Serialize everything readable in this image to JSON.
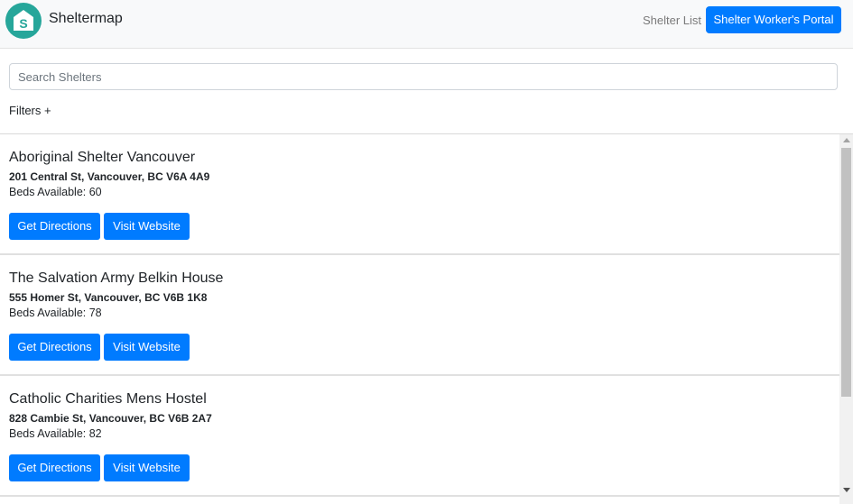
{
  "header": {
    "brand": "Sheltermap",
    "logo_icon": "house-s-logo-icon",
    "logo_color": "#26a69a",
    "nav_link": "Shelter List",
    "portal_button": "Shelter Worker's Portal",
    "accent": "#007bff"
  },
  "search": {
    "placeholder": "Search Shelters",
    "value": "",
    "filters_label": "Filters +"
  },
  "shelters": [
    {
      "name": "Aboriginal Shelter Vancouver",
      "address": "201 Central St, Vancouver, BC V6A 4A9",
      "beds": "Beds Available: 60",
      "directions_label": "Get Directions",
      "website_label": "Visit Website"
    },
    {
      "name": "The Salvation Army Belkin House",
      "address": "555 Homer St, Vancouver, BC V6B 1K8",
      "beds": "Beds Available: 78",
      "directions_label": "Get Directions",
      "website_label": "Visit Website"
    },
    {
      "name": "Catholic Charities Mens Hostel",
      "address": "828 Cambie St, Vancouver, BC V6B 2A7",
      "beds": "Beds Available: 82",
      "directions_label": "Get Directions",
      "website_label": "Visit Website"
    }
  ]
}
